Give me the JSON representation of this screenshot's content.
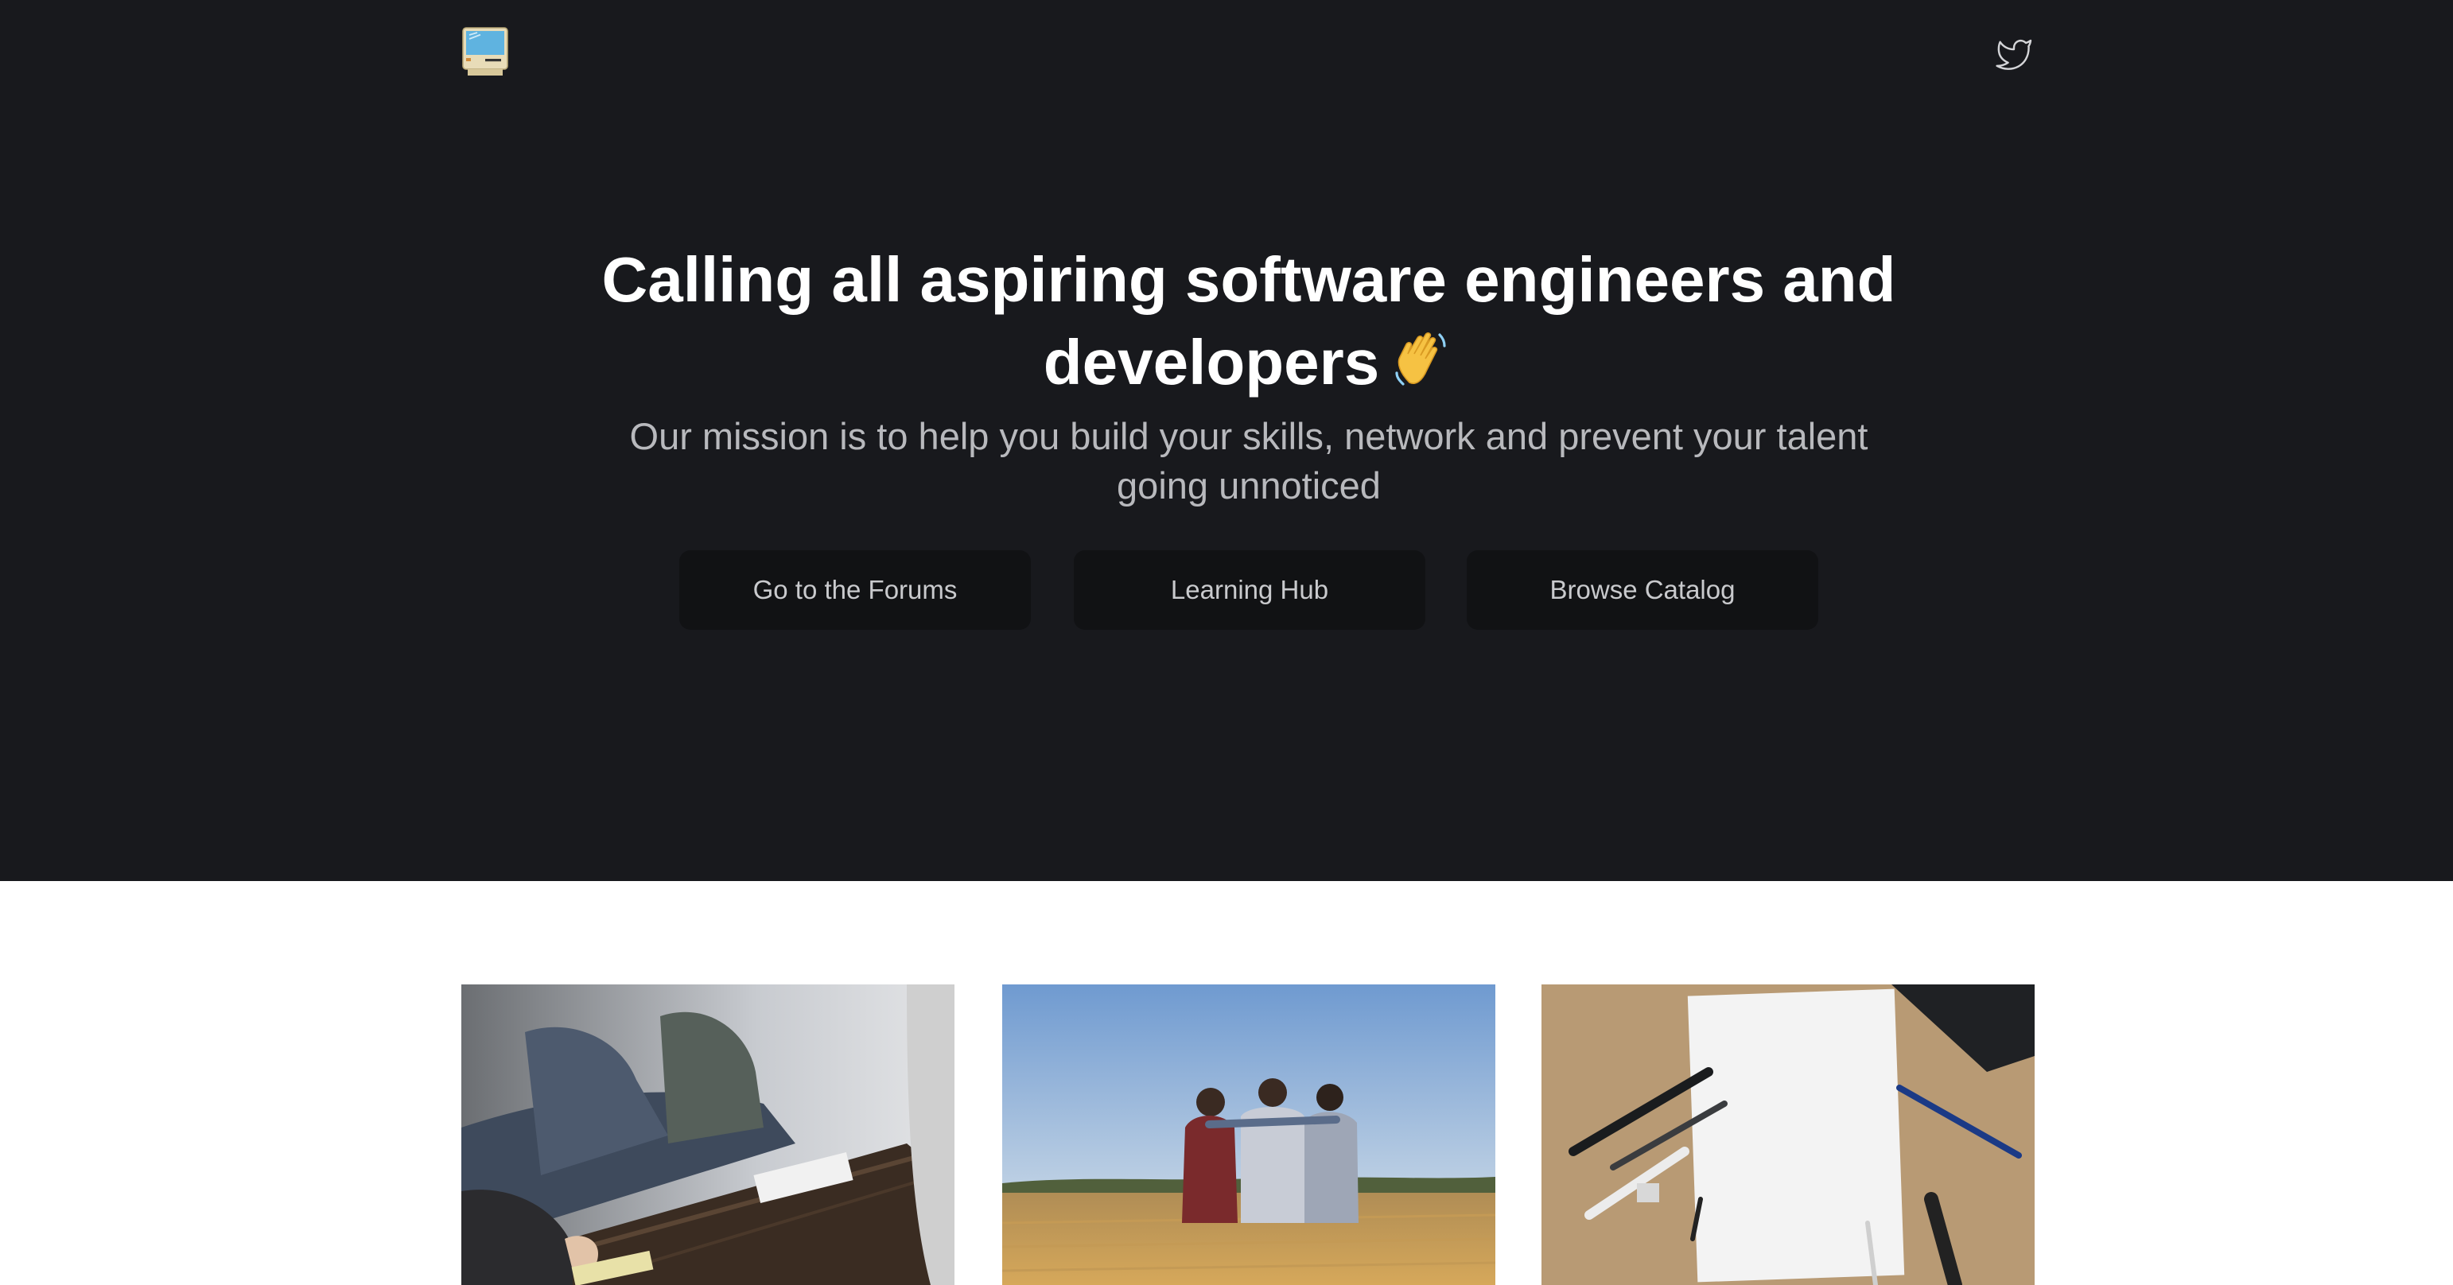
{
  "header": {
    "logo_icon": "retro-computer-icon",
    "social_icon": "twitter-icon"
  },
  "hero": {
    "headline_line1": "Calling all aspiring software engineers and",
    "headline_line2": "developers",
    "headline_emoji_icon": "waving-hand-icon",
    "subheadline_line1": "Our mission is to help you build your skills, network and prevent your talent",
    "subheadline_line2": "going unnoticed",
    "buttons": [
      {
        "label": "Go to the Forums"
      },
      {
        "label": "Learning Hub"
      },
      {
        "label": "Browse Catalog"
      }
    ]
  },
  "cards": [
    {
      "image": "people-at-meeting-table-photo"
    },
    {
      "image": "friends-in-field-photo"
    },
    {
      "image": "blank-paper-with-pens-photo"
    }
  ],
  "colors": {
    "hero_background": "#18191d",
    "button_background": "#111214",
    "headline_text": "#ffffff",
    "subheadline_text": "#b8b9bd",
    "page_background": "#ffffff"
  }
}
